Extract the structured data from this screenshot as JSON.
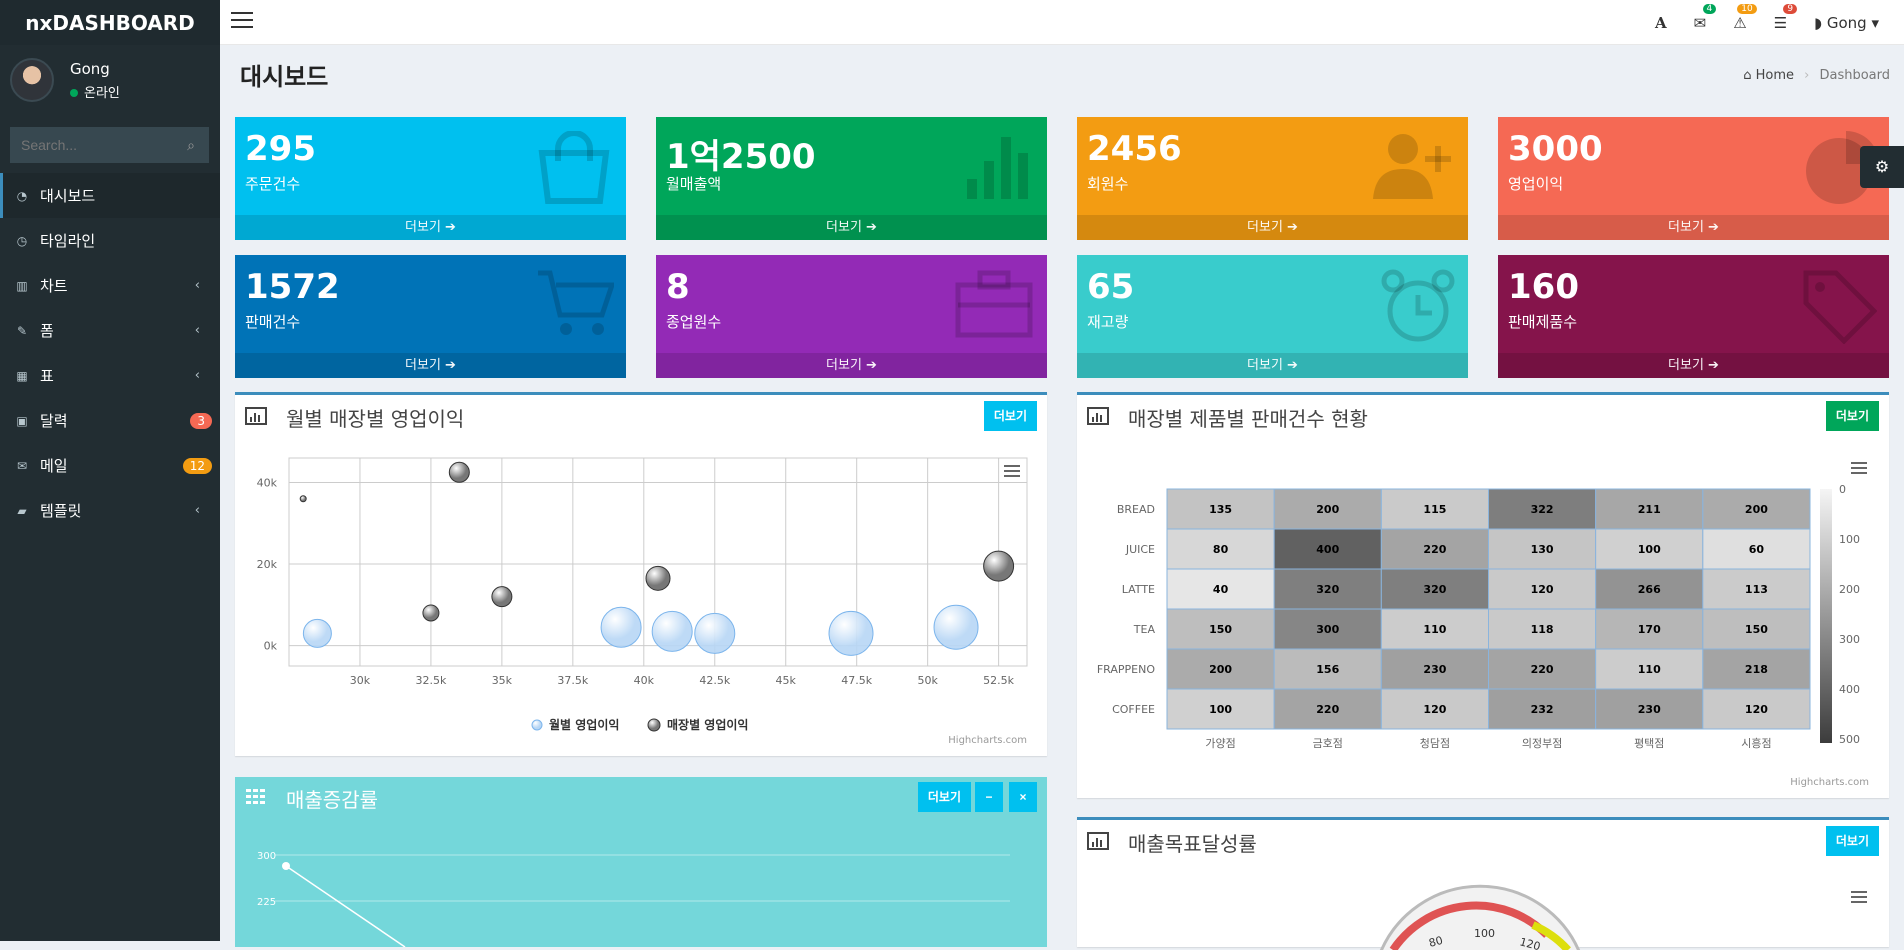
{
  "app": {
    "brand": "nxDASHBOARD"
  },
  "user": {
    "name": "Gong",
    "status": "온라인"
  },
  "search": {
    "placeholder": "Search..."
  },
  "sidebar": {
    "items": [
      {
        "label": "대시보드",
        "icon": "dashboard-icon"
      },
      {
        "label": "타임라인",
        "icon": "clock-icon"
      },
      {
        "label": "차트",
        "icon": "bar-chart-icon"
      },
      {
        "label": "폼",
        "icon": "edit-icon"
      },
      {
        "label": "표",
        "icon": "table-icon"
      },
      {
        "label": "달력",
        "icon": "calendar-icon",
        "badge": "3"
      },
      {
        "label": "메일",
        "icon": "mail-icon",
        "badge": "12"
      },
      {
        "label": "템플릿",
        "icon": "folder-icon"
      }
    ]
  },
  "topbar": {
    "font_icon": "A",
    "mail_count": "4",
    "alert_count": "10",
    "task_count": "9",
    "user": "Gong"
  },
  "page": {
    "title": "대시보드",
    "breadcrumb_home": "Home",
    "breadcrumb_current": "Dashboard"
  },
  "tiles": [
    {
      "value": "295",
      "label": "주문건수",
      "more": "더보기 ➔",
      "color": "#00c0ef"
    },
    {
      "value": "1억2500",
      "label": "월매출액",
      "more": "더보기 ➔",
      "color": "#00a65a"
    },
    {
      "value": "2456",
      "label": "회원수",
      "more": "더보기 ➔",
      "color": "#f39c12"
    },
    {
      "value": "3000",
      "label": "영업이익",
      "more": "더보기 ➔",
      "color": "#f56954"
    },
    {
      "value": "1572",
      "label": "판매건수",
      "more": "더보기 ➔",
      "color": "#0073b7"
    },
    {
      "value": "8",
      "label": "종업원수",
      "more": "더보기 ➔",
      "color": "#932ab6"
    },
    {
      "value": "65",
      "label": "재고량",
      "more": "더보기 ➔",
      "color": "#39cccc"
    },
    {
      "value": "160",
      "label": "판매제품수",
      "more": "더보기 ➔",
      "color": "#85144b"
    }
  ],
  "boxes": {
    "bubble_title": "월별 매장별 영업이익",
    "heatmap_title": "매장별 제품별 판매건수 현황",
    "growth_title": "매출증감률",
    "gauge_title": "매출목표달성률",
    "more_label": "더보기",
    "minus_label": "−",
    "close_label": "×",
    "credit": "Highcharts.com"
  },
  "chart_data": [
    {
      "type": "scatter",
      "title": "월별 매장별 영업이익",
      "xlim": [
        27500,
        53500
      ],
      "ylim": [
        -5000,
        46000
      ],
      "xticks": [
        "30k",
        "32.5k",
        "35k",
        "37.5k",
        "40k",
        "42.5k",
        "45k",
        "47.5k",
        "50k",
        "52.5k"
      ],
      "yticks": [
        "0k",
        "20k",
        "40k"
      ],
      "legend": "bottom",
      "series": [
        {
          "name": "월별 영업이익",
          "points": [
            [
              28500,
              3000,
              10
            ],
            [
              39200,
              4500,
              16
            ],
            [
              41000,
              3500,
              16
            ],
            [
              42500,
              3000,
              16
            ],
            [
              47300,
              3000,
              18
            ],
            [
              51000,
              4500,
              18
            ]
          ]
        },
        {
          "name": "매장별 영업이익",
          "points": [
            [
              28000,
              36000,
              3
            ],
            [
              33500,
              42500,
              10
            ],
            [
              32500,
              8000,
              8
            ],
            [
              35000,
              12000,
              10
            ],
            [
              40500,
              16500,
              12
            ],
            [
              52500,
              19500,
              15
            ]
          ]
        }
      ]
    },
    {
      "type": "heatmap",
      "title": "매장별 제품별 판매건수 현황",
      "x": [
        "가양점",
        "금호점",
        "청담점",
        "의정부점",
        "평택점",
        "시흥점"
      ],
      "y": [
        "BREAD",
        "JUICE",
        "LATTE",
        "TEA",
        "FRAPPENO",
        "COFFEE"
      ],
      "values": [
        [
          135,
          200,
          115,
          322,
          211,
          200
        ],
        [
          80,
          400,
          220,
          130,
          100,
          60
        ],
        [
          40,
          320,
          320,
          120,
          266,
          113
        ],
        [
          150,
          300,
          110,
          118,
          170,
          150
        ],
        [
          200,
          156,
          230,
          220,
          110,
          218
        ],
        [
          100,
          220,
          120,
          232,
          230,
          120
        ]
      ],
      "color_axis": {
        "min": 0,
        "max": 500,
        "ticks": [
          "0",
          "100",
          "200",
          "300",
          "400",
          "500"
        ]
      }
    },
    {
      "type": "line",
      "title": "매출증감률",
      "yticks": [
        "300",
        "225"
      ]
    }
  ]
}
